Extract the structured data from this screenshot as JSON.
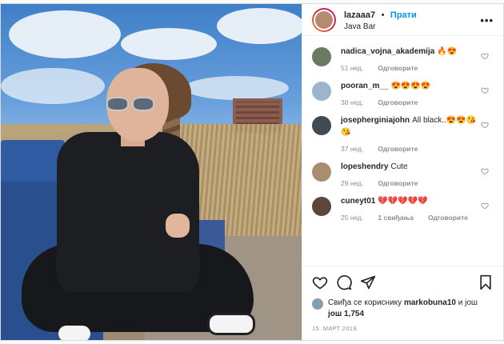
{
  "header": {
    "username": "lazaaa7",
    "separator": "•",
    "follow_label": "Прати",
    "location": "Java Bar",
    "more_label": "•••"
  },
  "comments": [
    {
      "user": "nadica_vojna_akademija",
      "text": "🔥😍",
      "time": "51 нед.",
      "reply_label": "Одговорите",
      "likes": "",
      "avatar_color": "#6b7a62"
    },
    {
      "user": "pooran_m__",
      "text": "😍😍😍😍",
      "time": "38 нед.",
      "reply_label": "Одговорите",
      "likes": "",
      "avatar_color": "#9bb5cf"
    },
    {
      "user": "josepherginiajohn",
      "text": "All black..😍😍😘😘",
      "time": "37 нед.",
      "reply_label": "Одговорите",
      "likes": "",
      "avatar_color": "#3f4a52"
    },
    {
      "user": "lopeshendry",
      "text": "Cute",
      "time": "29 нед.",
      "reply_label": "Одговорите",
      "likes": "",
      "avatar_color": "#a88d6e"
    },
    {
      "user": "cuneyt01",
      "text": "💔💔💔💔💔",
      "time": "25 нед.",
      "reply_label": "Одговорите",
      "likes": "1 свиђања",
      "avatar_color": "#5c4638"
    }
  ],
  "likes": {
    "prefix": "Свиђа се кориснику",
    "user": "markobuna10",
    "middle": "и још",
    "count": "још 1,754"
  },
  "date": "15. МАРТ 2019.",
  "colors": {
    "accent": "#0095f6",
    "heart_red": "#e0245e"
  },
  "icons": [
    "heart-icon",
    "comment-icon",
    "share-icon",
    "bookmark-icon",
    "more-icon"
  ]
}
